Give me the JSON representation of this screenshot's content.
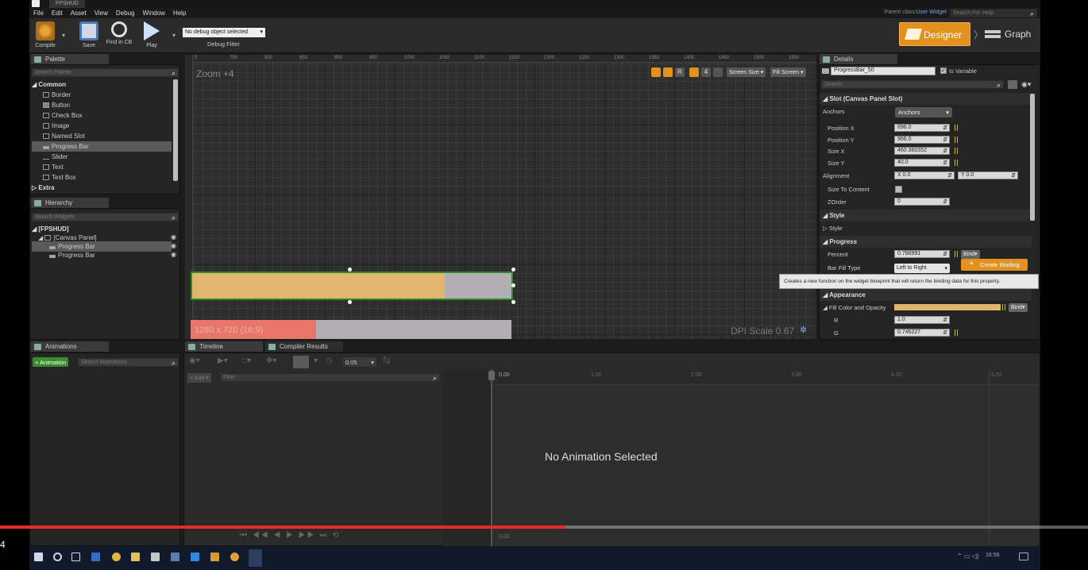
{
  "window": {
    "title": "FPSHUD"
  },
  "menu": [
    "File",
    "Edit",
    "Asset",
    "View",
    "Debug",
    "Window",
    "Help"
  ],
  "top_right": {
    "parent_class_label": "Parent class:",
    "parent_class_value": "User Widget",
    "help_search_placeholder": "Search For Help"
  },
  "toolbar": {
    "compile": "Compile",
    "save": "Save",
    "find_in_cb": "Find in CB",
    "play": "Play",
    "debug_object": "No debug object selected",
    "debug_filter": "Debug Filter",
    "designer": "Designer",
    "graph": "Graph"
  },
  "palette": {
    "tab": "Palette",
    "search_placeholder": "Search Palette",
    "category_common": "Common",
    "items": [
      "Border",
      "Button",
      "Check Box",
      "Image",
      "Named Slot",
      "Progress Bar",
      "Slider",
      "Text",
      "Text Box"
    ],
    "category_extra": "Extra"
  },
  "hierarchy": {
    "tab": "Hierarchy",
    "search_placeholder": "Search Widgets",
    "root": "[FPSHUD]",
    "canvas": "[Canvas Panel]",
    "children": [
      "Progress Bar",
      "Progress Bar"
    ]
  },
  "designer_canvas": {
    "zoom": "Zoom +4",
    "ruler_ticks": [
      "0",
      "750",
      "800",
      "850",
      "900",
      "950",
      "1000",
      "1050",
      "1100",
      "1150",
      "1200",
      "1250",
      "1300",
      "1350",
      "1400",
      "1450",
      "1500",
      "1550"
    ],
    "screen_size": "Screen Size",
    "fill_screen": "Fill Screen",
    "r_button": "R",
    "grid_value": "4",
    "resolution": "1280 x 720 (16:9)",
    "dpi_scale": "DPI Scale 0.67",
    "bar1_percent": 0.79,
    "bar2_percent": 0.39,
    "colors": {
      "fill1": "#e0b56e",
      "fill2": "#e8776a",
      "track": "#b3aeb4",
      "outline": "#2c8a2c"
    }
  },
  "details": {
    "tab": "Details",
    "widget_name": "ProgressBar_50",
    "is_variable": "Is Variable",
    "search_placeholder": "Search",
    "slot_section": "Slot (Canvas Panel Slot)",
    "anchors_label": "Anchors",
    "anchors_value": "Anchors",
    "position_x_label": "Position X",
    "position_x": "696.0",
    "position_y_label": "Position Y",
    "position_y": "956.0",
    "size_x_label": "Size X",
    "size_x": "460.360352",
    "size_y_label": "Size Y",
    "size_y": "40.0",
    "alignment_label": "Alignment",
    "alignment_x": "X 0.0",
    "alignment_y": "Y 0.0",
    "size_to_content": "Size To Content",
    "zorder_label": "ZOrder",
    "zorder": "0",
    "style_section": "Style",
    "style_label": "Style",
    "progress_section": "Progress",
    "percent_label": "Percent",
    "percent": "0.788991",
    "bind": "Bind",
    "bar_fill_type_label": "Bar Fill Type",
    "bar_fill_type": "Left to Right",
    "create_binding": "Create Binding",
    "tooltip": "Creates a new function on the widget blueprint that will return the binding data for this property.",
    "appearance_section": "Appearance",
    "fill_color_label": "Fill Color and Opacity",
    "r_label": "R",
    "r_value": "1.0",
    "g_label": "G",
    "g_value": "0.746227",
    "fill_color": "#e0b56e"
  },
  "animations": {
    "tab": "Animations",
    "add_button": "+ Animation",
    "search_placeholder": "Search Animations"
  },
  "timeline": {
    "tab1": "Timeline",
    "tab2": "Compiler Results",
    "fps_value": "0.05",
    "add_track": "+ Add",
    "filter_placeholder": "Filter",
    "start_time": "0.00",
    "ticks": [
      "1.00",
      "2.00",
      "3.00",
      "4.00",
      "5.00"
    ],
    "empty_message": "No Animation Selected",
    "bottom_time": "0.00"
  },
  "video": {
    "progress": 0.52,
    "timestamp": "4"
  },
  "taskbar": {
    "clock": "16:56"
  }
}
